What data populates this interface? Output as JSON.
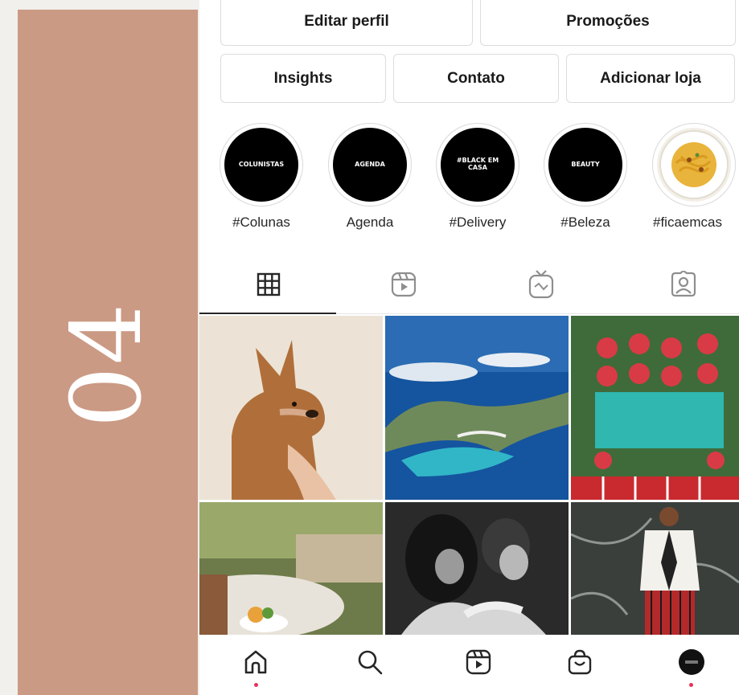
{
  "slide": {
    "number": "04"
  },
  "profile_buttons": {
    "edit_profile": "Editar perfil",
    "promotions": "Promoções",
    "insights": "Insights",
    "contact": "Contato",
    "add_shop": "Adicionar loja"
  },
  "highlights": [
    {
      "cover_text": "COLUNISTAS",
      "label": "#Colunas"
    },
    {
      "cover_text": "AGENDA",
      "label": "Agenda"
    },
    {
      "cover_text": "#BLACK EM CASA",
      "label": "#Delivery"
    },
    {
      "cover_text": "BEAUTY",
      "label": "#Beleza"
    },
    {
      "cover_text": "",
      "label": "#ficaemcas"
    }
  ],
  "profile_tabs": [
    {
      "icon": "grid-icon",
      "active": true
    },
    {
      "icon": "reels-icon",
      "active": false
    },
    {
      "icon": "igtv-icon",
      "active": false
    },
    {
      "icon": "tagged-icon",
      "active": false
    }
  ],
  "posts": [
    {
      "subject": "dog"
    },
    {
      "subject": "coastline"
    },
    {
      "subject": "pool"
    },
    {
      "subject": "restaurant"
    },
    {
      "subject": "couple"
    },
    {
      "subject": "fashion"
    }
  ],
  "bottom_nav": [
    {
      "icon": "home-icon"
    },
    {
      "icon": "search-icon"
    },
    {
      "icon": "reels-icon"
    },
    {
      "icon": "shop-icon"
    },
    {
      "icon": "profile-avatar"
    }
  ],
  "colors": {
    "accent_panel": "#cb9a84",
    "notification_dot": "#e8325b"
  }
}
